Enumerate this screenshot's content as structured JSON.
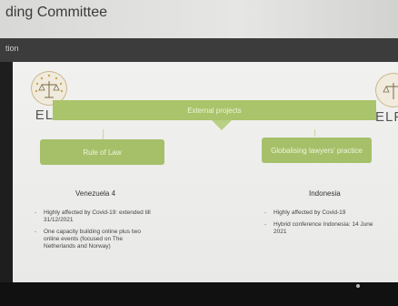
{
  "window": {
    "title": "ding Committee"
  },
  "toolbar": {
    "label": "tion"
  },
  "slide": {
    "logo_left_text": "ELF",
    "logo_right_text": "ELF",
    "banner_label": "External projects",
    "left": {
      "pill_label": "Rule of Law",
      "heading": "Venezuela 4",
      "bullets": [
        "Highly affected by Covid-19: extended till 31/12/2021",
        "One capacity building online plus two online events (focused on The Netherlands and Norway)"
      ]
    },
    "right": {
      "pill_label": "Globalising lawyers' practice",
      "heading": "Indonesia",
      "bullets": [
        "Highly affected by Covid-19",
        "Hybrid conference Indonesia: 14 June 2021"
      ]
    }
  },
  "colors": {
    "accent_green": "#a9c46a",
    "slide_bg": "#efefed"
  }
}
